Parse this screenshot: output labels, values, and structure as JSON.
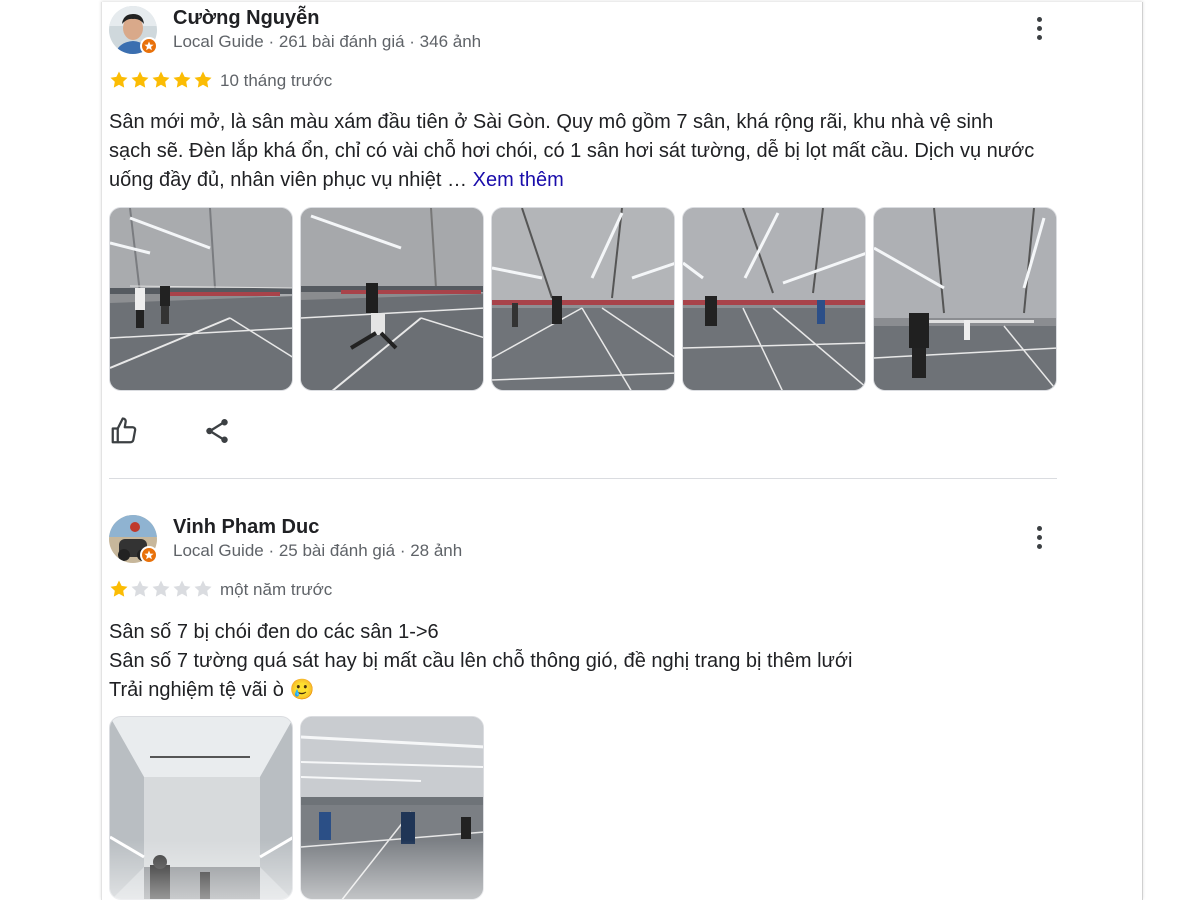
{
  "reviews": [
    {
      "author": "Cường Nguyễn",
      "meta": "Local Guide · 261 bài đánh giá · 346 ảnh",
      "rating": 5,
      "time": "10 tháng trước",
      "text": "Sân mới mở, là sân màu xám đầu tiên ở Sài Gòn. Quy mô gồm 7 sân, khá rộng rãi, khu nhà vệ sinh sạch sẽ. Đèn lắp khá ổn, chỉ có vài chỗ hơi chói, có 1 sân hơi sát tường, dễ bị lọt mất cầu. Dịch vụ nước uống đầy đủ, nhân viên phục vụ nhiệt …",
      "more_label": "Xem thêm",
      "photo_count": 5
    },
    {
      "author": "Vinh Pham Duc",
      "meta": "Local Guide · 25 bài đánh giá · 28 ảnh",
      "rating": 1,
      "time": "một năm trước",
      "lines": [
        "Sân số 7 bị chói đen do các sân 1->6",
        "Sân số 7 tường quá sát hay bị mất cầu lên chỗ thông gió, đề nghị trang bị thêm lưới",
        "Trải nghiệm tệ vãi ò 🥲"
      ],
      "photo_count": 2
    }
  ],
  "icons": {
    "like": "thumb-up-icon",
    "share": "share-icon",
    "menu": "more-vert-icon",
    "badge": "local-guide-badge-icon"
  },
  "colors": {
    "star_filled": "#fbbc04",
    "star_empty": "#dadce0",
    "link": "#1a0dab",
    "badge": "#e8710a"
  }
}
